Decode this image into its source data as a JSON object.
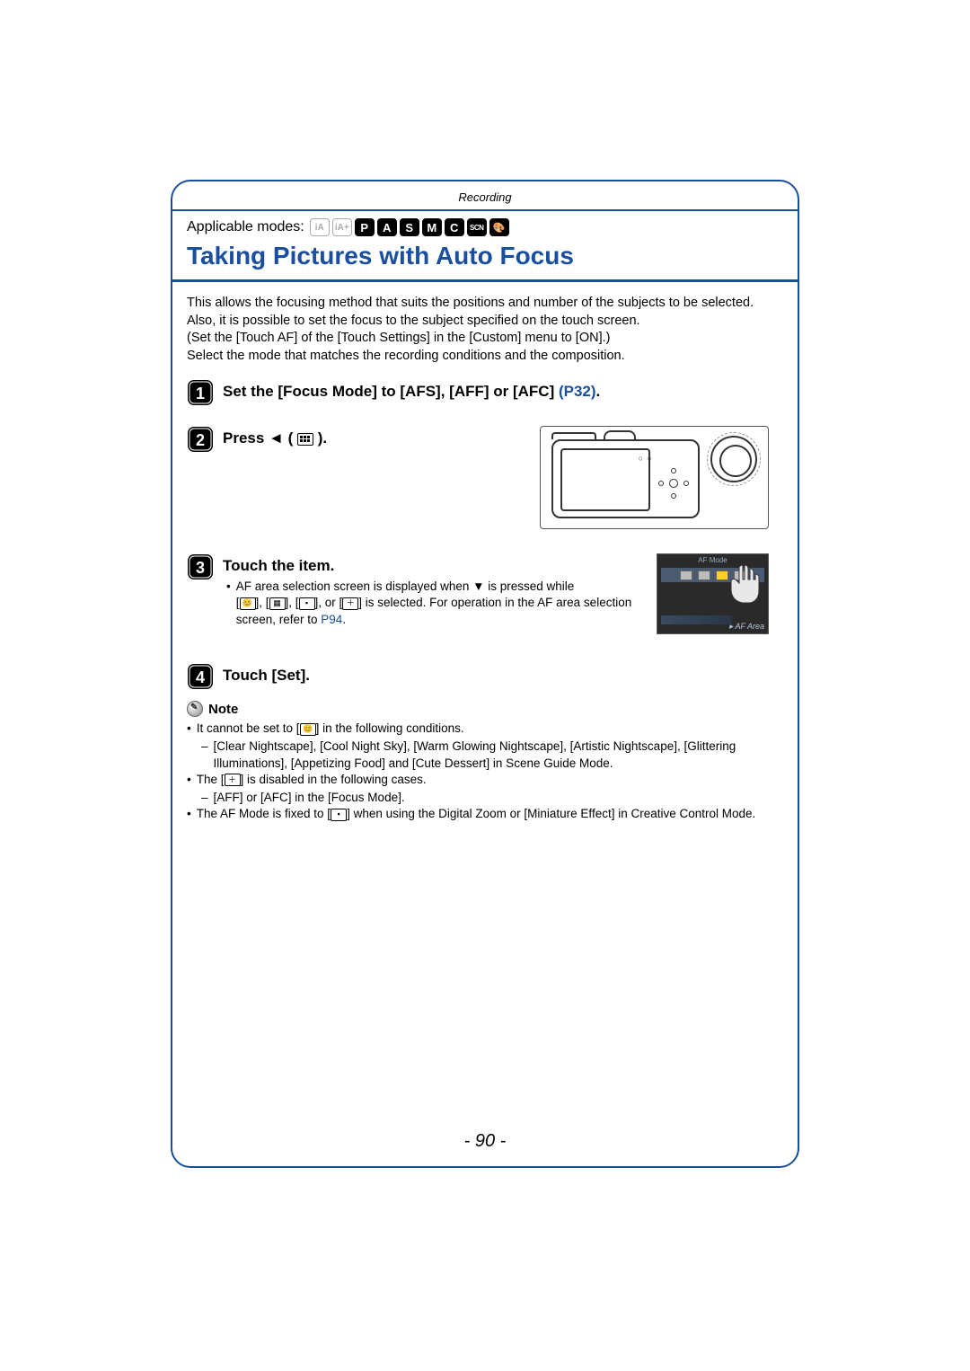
{
  "section_header": "Recording",
  "applicable_label": "Applicable modes:",
  "mode_icons": {
    "ia": "iA",
    "ia_plus": "iA+",
    "p": "P",
    "a": "A",
    "s": "S",
    "m": "M",
    "c": "C",
    "scn": "SCN",
    "palette": "🎨"
  },
  "title": "Taking Pictures with Auto Focus",
  "intro_p1": "This allows the focusing method that suits the positions and number of the subjects to be selected.",
  "intro_p2": "Also, it is possible to set the focus to the subject specified on the touch screen.",
  "intro_p3": "(Set the [Touch AF] of the [Touch Settings] in the [Custom] menu to [ON].)",
  "intro_p4": "Select the mode that matches the recording conditions and the composition.",
  "steps": {
    "s1": {
      "title_a": "Set the [Focus Mode] to [AFS], [AFF] or [AFC] ",
      "ref": "(P32)",
      "title_b": "."
    },
    "s2": {
      "title_a": "Press ◄ ( ",
      "title_b": " )."
    },
    "s3": {
      "title": "Touch the item.",
      "bullet_a": "AF area selection screen is displayed when ▼ is pressed while",
      "bullet_b_pre": "[",
      "bullet_b_mid1": "], [",
      "bullet_b_mid2": "], [",
      "bullet_b_mid3": "], or [",
      "bullet_b_post": "] is selected. For operation in the AF area selection screen, refer to ",
      "ref": "P94",
      "bullet_b_end": "."
    },
    "s4": {
      "title": "Touch [Set]."
    }
  },
  "note_label": "Note",
  "notes": {
    "n1_a": "It cannot be set to [",
    "n1_b": "] in the following conditions.",
    "n1_sub": "[Clear Nightscape], [Cool Night Sky], [Warm Glowing Nightscape], [Artistic Nightscape], [Glittering Illuminations], [Appetizing Food] and [Cute Dessert] in Scene Guide Mode.",
    "n2_a": "The [",
    "n2_b": "] is disabled in the following cases.",
    "n2_sub": "[AFF] or [AFC] in the [Focus Mode].",
    "n3_a": "The AF Mode is fixed to [",
    "n3_b": "] when using the Digital Zoom or [Miniature Effect] in Creative Control Mode."
  },
  "touch_label": "▸ AF Area",
  "page_number": "- 90 -"
}
